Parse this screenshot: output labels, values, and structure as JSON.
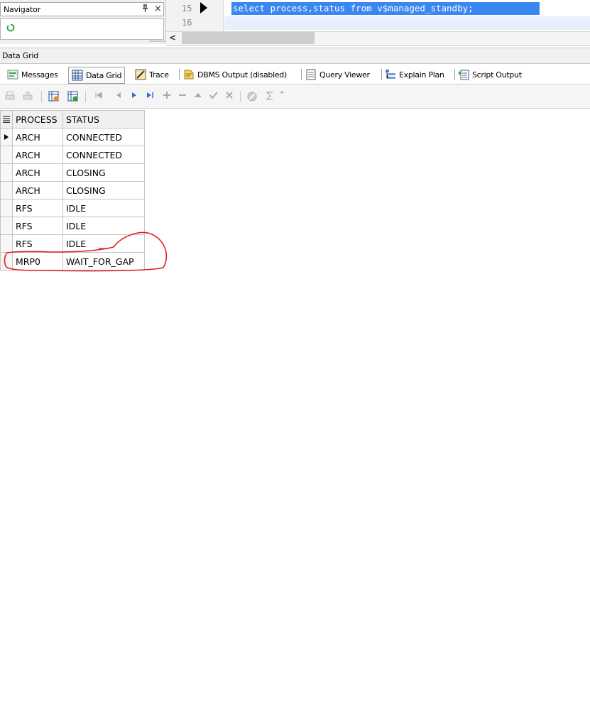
{
  "navigator": {
    "title": "Navigator",
    "pin_glyph": "ᵪ",
    "close_glyph": "×"
  },
  "editor": {
    "line_numbers": [
      "15",
      "16"
    ],
    "code_line": "select process,status from v$managed_standby;",
    "scroll_left": "<"
  },
  "data_grid_strip": {
    "label": "Data Grid"
  },
  "tabs": [
    {
      "label": "Messages",
      "icon": "messages-icon"
    },
    {
      "label": "Data Grid",
      "icon": "grid-icon",
      "active": true
    },
    {
      "label": "Trace",
      "icon": "trace-icon"
    },
    {
      "label": "DBMS Output (disabled)",
      "icon": "dbms-output-icon"
    },
    {
      "label": "Query Viewer",
      "icon": "document-icon"
    },
    {
      "label": "Explain Plan",
      "icon": "explain-plan-icon"
    },
    {
      "label": "Script Output",
      "icon": "script-output-icon"
    }
  ],
  "grid": {
    "columns": [
      "PROCESS",
      "STATUS"
    ],
    "rows": [
      [
        "ARCH",
        "CONNECTED"
      ],
      [
        "ARCH",
        "CONNECTED"
      ],
      [
        "ARCH",
        "CLOSING"
      ],
      [
        "ARCH",
        "CLOSING"
      ],
      [
        "RFS",
        "IDLE"
      ],
      [
        "RFS",
        "IDLE"
      ],
      [
        "RFS",
        "IDLE"
      ],
      [
        "MRP0",
        "WAIT_FOR_GAP"
      ]
    ]
  },
  "colors": {
    "selection": "#3a87f2",
    "annotation": "#e02020"
  }
}
